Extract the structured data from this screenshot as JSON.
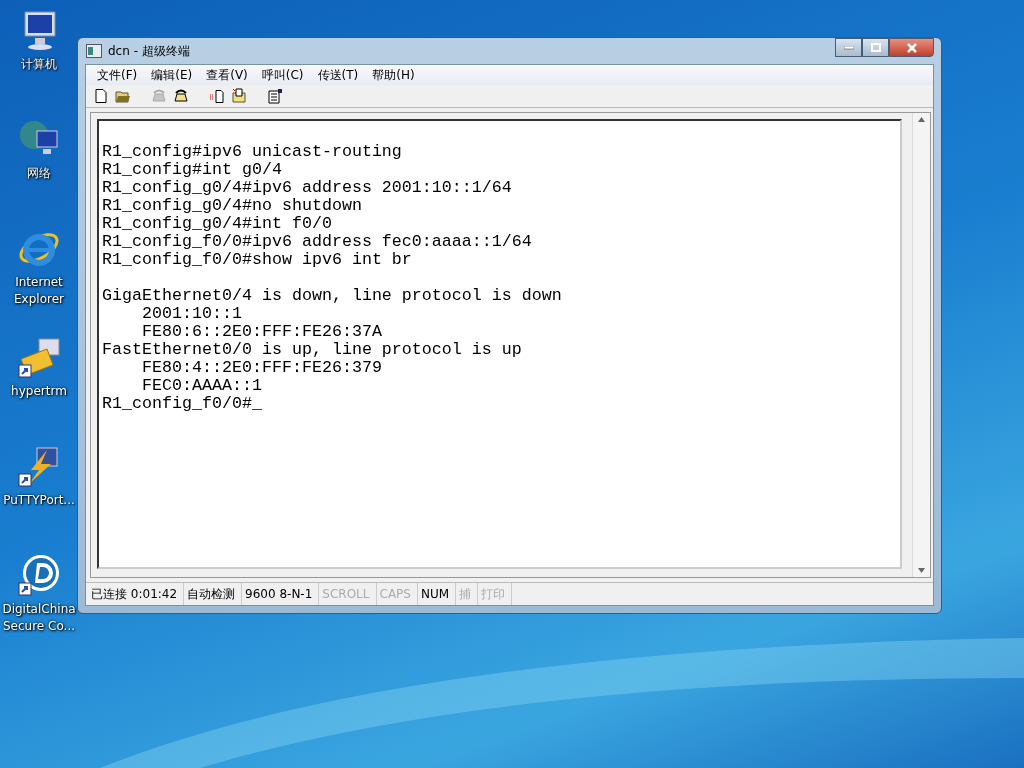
{
  "desktop_icons": [
    {
      "label": "计算机",
      "kind": "computer"
    },
    {
      "label": "网络",
      "kind": "network"
    },
    {
      "label": "Internet Explorer",
      "kind": "browser"
    },
    {
      "label": "hypertrm",
      "kind": "phone"
    },
    {
      "label": "PuTTYPort...",
      "kind": "bolt"
    },
    {
      "label": "DigitalChina Secure Co...",
      "kind": "disc"
    }
  ],
  "window": {
    "title": "dcn - 超级终端"
  },
  "menu": [
    "文件(F)",
    "编辑(E)",
    "查看(V)",
    "呼叫(C)",
    "传送(T)",
    "帮助(H)"
  ],
  "toolbar": [
    {
      "kind": "new",
      "disabled": false
    },
    {
      "kind": "open",
      "disabled": false
    },
    {
      "kind": "disconnect",
      "disabled": true
    },
    {
      "kind": "call",
      "disabled": false
    },
    {
      "kind": "send",
      "disabled": false
    },
    {
      "kind": "receive",
      "disabled": false
    },
    {
      "kind": "properties",
      "disabled": false
    }
  ],
  "terminal_blocks": [
    [
      "R1_config#ipv6 unicast-routing",
      "R1_config#int g0/4",
      "R1_config_g0/4#ipv6 address 2001:10::1/64",
      "R1_config_g0/4#no shutdown",
      "R1_config_g0/4#int f0/0",
      "R1_config_f0/0#ipv6 address fec0:aaaa::1/64",
      "R1_config_f0/0#show ipv6 int br"
    ],
    [
      "GigaEthernet0/4 is down, line protocol is down",
      "    2001:10::1",
      "    FE80:6::2E0:FFF:FE26:37A",
      "FastEthernet0/0 is up, line protocol is up",
      "    FE80:4::2E0:FFF:FE26:379",
      "    FEC0:AAAA::1",
      "R1_config_f0/0#_"
    ]
  ],
  "status_bar": [
    {
      "text": "已连接 0:01:42",
      "on": true
    },
    {
      "text": "自动检测",
      "on": true
    },
    {
      "text": "9600 8-N-1",
      "on": true
    },
    {
      "text": "SCROLL",
      "on": false
    },
    {
      "text": "CAPS",
      "on": false
    },
    {
      "text": "NUM",
      "on": true
    },
    {
      "text": "捕",
      "on": false
    },
    {
      "text": "打印",
      "on": false
    }
  ]
}
